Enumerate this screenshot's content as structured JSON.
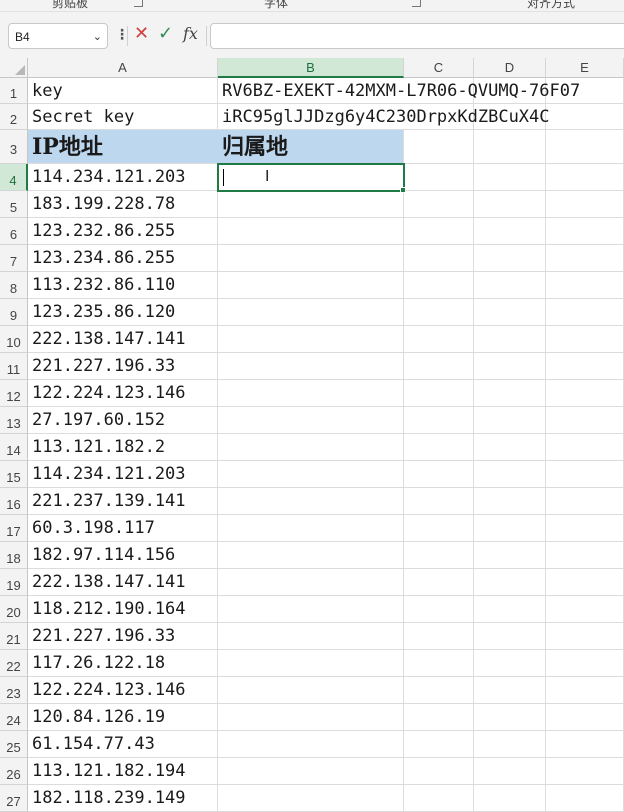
{
  "ribbon": {
    "groups": [
      "剪贴板",
      "字体",
      "对齐方式"
    ]
  },
  "formula_bar": {
    "name_box": "B4",
    "formula": "",
    "fx_label": "fx"
  },
  "columns": [
    "A",
    "B",
    "C",
    "D",
    "E"
  ],
  "selected_cell": "B4",
  "rows": [
    {
      "num": "1",
      "a": "key",
      "b": "RV6BZ-EXEKT-42MXM-L7R06-QVUMQ-76F07"
    },
    {
      "num": "2",
      "a": "Secret key",
      "b": "iRC95glJJDzg6y4C230DrpxKdZBCuX4C"
    },
    {
      "num": "3",
      "a": "IP地址",
      "b": "归属地"
    },
    {
      "num": "4",
      "a": "114.234.121.203",
      "b": ""
    },
    {
      "num": "5",
      "a": "183.199.228.78",
      "b": ""
    },
    {
      "num": "6",
      "a": "123.232.86.255",
      "b": ""
    },
    {
      "num": "7",
      "a": "123.234.86.255",
      "b": ""
    },
    {
      "num": "8",
      "a": "113.232.86.110",
      "b": ""
    },
    {
      "num": "9",
      "a": "123.235.86.120",
      "b": ""
    },
    {
      "num": "10",
      "a": "222.138.147.141",
      "b": ""
    },
    {
      "num": "11",
      "a": "221.227.196.33",
      "b": ""
    },
    {
      "num": "12",
      "a": "122.224.123.146",
      "b": ""
    },
    {
      "num": "13",
      "a": "27.197.60.152",
      "b": ""
    },
    {
      "num": "14",
      "a": "113.121.182.2",
      "b": ""
    },
    {
      "num": "15",
      "a": "114.234.121.203",
      "b": ""
    },
    {
      "num": "16",
      "a": "221.237.139.141",
      "b": ""
    },
    {
      "num": "17",
      "a": "60.3.198.117",
      "b": ""
    },
    {
      "num": "18",
      "a": "182.97.114.156",
      "b": ""
    },
    {
      "num": "19",
      "a": "222.138.147.141",
      "b": ""
    },
    {
      "num": "20",
      "a": "118.212.190.164",
      "b": ""
    },
    {
      "num": "21",
      "a": "221.227.196.33",
      "b": ""
    },
    {
      "num": "22",
      "a": "117.26.122.18",
      "b": ""
    },
    {
      "num": "23",
      "a": "122.224.123.146",
      "b": ""
    },
    {
      "num": "24",
      "a": "120.84.126.19",
      "b": ""
    },
    {
      "num": "25",
      "a": "61.154.77.43",
      "b": ""
    },
    {
      "num": "26",
      "a": "113.121.182.194",
      "b": ""
    },
    {
      "num": "27",
      "a": "182.118.239.149",
      "b": ""
    }
  ]
}
